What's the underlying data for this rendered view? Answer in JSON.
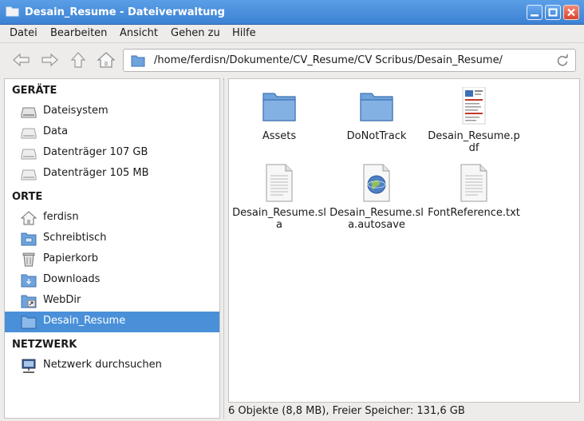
{
  "window": {
    "title": "Desain_Resume - Dateiverwaltung",
    "controls": [
      "minimize",
      "maximize",
      "close"
    ]
  },
  "menu": [
    "Datei",
    "Bearbeiten",
    "Ansicht",
    "Gehen zu",
    "Hilfe"
  ],
  "toolbar": {
    "buttons": [
      "back-icon",
      "forward-icon",
      "up-icon",
      "home-icon"
    ],
    "path": "/home/ferdisn/Dokumente/CV_Resume/CV Scribus/Desain_Resume/"
  },
  "sidebar": {
    "sections": [
      {
        "title": "GERÄTE",
        "items": [
          {
            "label": "Dateisystem",
            "icon": "drive-icon"
          },
          {
            "label": "Data",
            "icon": "drive-icon"
          },
          {
            "label": "Datenträger 107 GB",
            "icon": "drive-icon"
          },
          {
            "label": "Datenträger 105 MB",
            "icon": "drive-icon"
          }
        ]
      },
      {
        "title": "ORTE",
        "items": [
          {
            "label": "ferdisn",
            "icon": "home-icon"
          },
          {
            "label": "Schreibtisch",
            "icon": "desktop-folder-icon"
          },
          {
            "label": "Papierkorb",
            "icon": "trash-icon"
          },
          {
            "label": "Downloads",
            "icon": "downloads-folder-icon"
          },
          {
            "label": "WebDir",
            "icon": "link-folder-icon"
          },
          {
            "label": "Desain_Resume",
            "icon": "folder-icon",
            "selected": true
          }
        ]
      },
      {
        "title": "NETZWERK",
        "items": [
          {
            "label": "Netzwerk durchsuchen",
            "icon": "network-icon"
          }
        ]
      }
    ]
  },
  "files": [
    {
      "name": "Assets",
      "icon": "folder-icon"
    },
    {
      "name": "DoNotTrack",
      "icon": "folder-icon"
    },
    {
      "name": "Desain_Resume.pdf",
      "icon": "pdf-thumbnail-icon"
    },
    {
      "name": "Desain_Resume.sla",
      "icon": "document-icon"
    },
    {
      "name": "Desain_Resume.sla.autosave",
      "icon": "globe-document-icon"
    },
    {
      "name": "FontReference.txt",
      "icon": "text-document-icon"
    }
  ],
  "status": "6 Objekte (8,8 MB), Freier Speicher: 131,6 GB",
  "colors": {
    "titlebar": "#3d82d4",
    "selection": "#4a90d9",
    "folder": "#6fa3dc"
  }
}
